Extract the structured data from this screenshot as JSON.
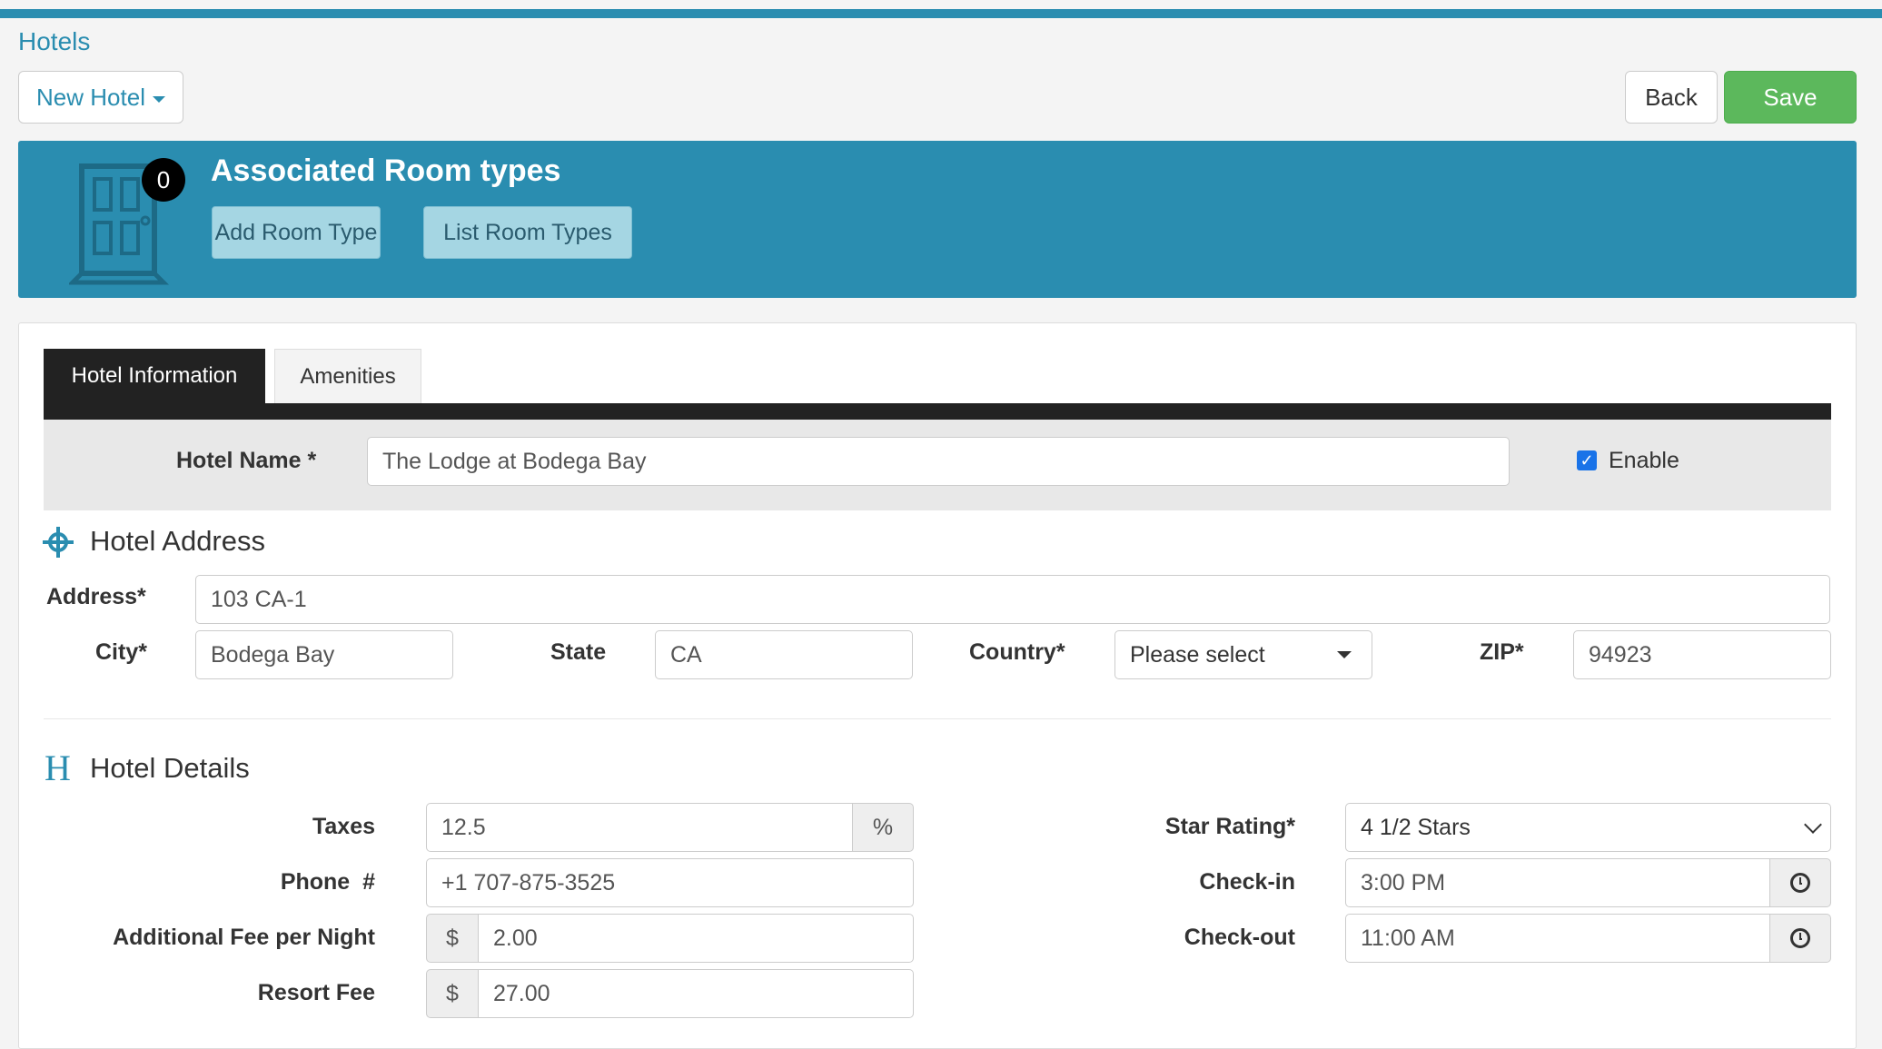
{
  "breadcrumb": "Hotels",
  "toolbar": {
    "new_hotel": "New Hotel",
    "back": "Back",
    "save": "Save"
  },
  "banner": {
    "count": "0",
    "title": "Associated Room types",
    "add_room_type": "Add Room Type",
    "list_room_types": "List Room Types"
  },
  "tabs": {
    "info": "Hotel Information",
    "amenities": "Amenities"
  },
  "hotel_name": {
    "label": "Hotel Name *",
    "value": "The Lodge at Bodega Bay",
    "enable_label": "Enable",
    "enabled": true
  },
  "address_section": {
    "title": "Hotel Address",
    "address_label": "Address*",
    "address": "103 CA-1",
    "city_label": "City*",
    "city": "Bodega Bay",
    "state_label": "State",
    "state": "CA",
    "country_label": "Country*",
    "country": "Please select",
    "zip_label": "ZIP*",
    "zip": "94923"
  },
  "details_section": {
    "icon_letter": "H",
    "title": "Hotel Details",
    "taxes_label": "Taxes",
    "taxes": "12.5",
    "taxes_unit": "%",
    "phone_label": "Phone  #",
    "phone": "+1 707-875-3525",
    "fee_label": "Additional Fee per Night",
    "fee_currency": "$",
    "fee": "2.00",
    "resort_label": "Resort Fee",
    "resort_currency": "$",
    "resort": "27.00",
    "star_label": "Star Rating*",
    "star": "4 1/2 Stars",
    "checkin_label": "Check-in",
    "checkin": "3:00 PM",
    "checkout_label": "Check-out",
    "checkout": "11:00 AM"
  },
  "colors": {
    "accent": "#2a8db0",
    "save": "#5cb85c",
    "tab_dark": "#222222"
  }
}
